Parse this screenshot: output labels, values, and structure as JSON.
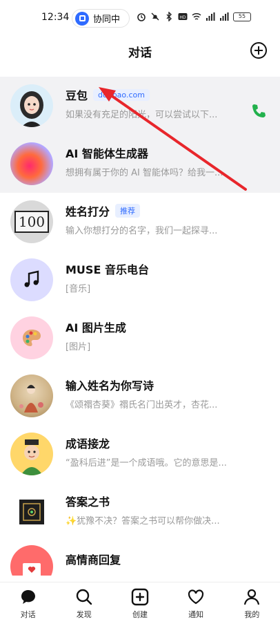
{
  "status_bar": {
    "time": "12:34",
    "collab_label": "协同中",
    "battery": "55",
    "icons": [
      "alarm-icon",
      "mute-icon",
      "bluetooth-icon",
      "hd-icon",
      "wifi-icon",
      "signal-icon",
      "signal-icon",
      "battery-icon"
    ]
  },
  "header": {
    "title": "对话",
    "add_icon": "plus-circle-icon"
  },
  "conversations": [
    {
      "title": "豆包",
      "badge": "doubao.com",
      "subtitle": "如果没有充足的阳光，可以尝试以下...",
      "call_icon": "phone-icon"
    },
    {
      "title": "AI 智能体生成器",
      "subtitle": "想拥有属于你的 AI 智能体吗？给我一..."
    },
    {
      "title": "姓名打分",
      "badge": "推荐",
      "subtitle": "输入你想打分的名字，我们一起探寻..."
    },
    {
      "title": "MUSE 音乐电台",
      "subtitle": "[音乐]"
    },
    {
      "title": "AI 图片生成",
      "subtitle": "[图片]"
    },
    {
      "title": "输入姓名为你写诗",
      "subtitle": "《颂禤杏葵》禤氏名门出英才，杏花..."
    },
    {
      "title": "成语接龙",
      "subtitle": "“盈科后进”是一个成语哦。它的意思是..."
    },
    {
      "title": "答案之书",
      "subtitle": "✨犹豫不决？答案之书可以帮你做决..."
    },
    {
      "title": "高情商回复",
      "subtitle": ""
    }
  ],
  "avatar_100_text": "100",
  "tabbar": [
    {
      "label": "对话",
      "icon": "chat-bubble-icon"
    },
    {
      "label": "发现",
      "icon": "search-icon"
    },
    {
      "label": "创建",
      "icon": "plus-square-icon"
    },
    {
      "label": "通知",
      "icon": "heart-icon"
    },
    {
      "label": "我的",
      "icon": "person-icon"
    }
  ],
  "colors": {
    "accent_blue": "#2f6bff",
    "pinned_bg": "#f2f2f4",
    "call_green": "#22b14c",
    "arrow_red": "#e8262b"
  }
}
